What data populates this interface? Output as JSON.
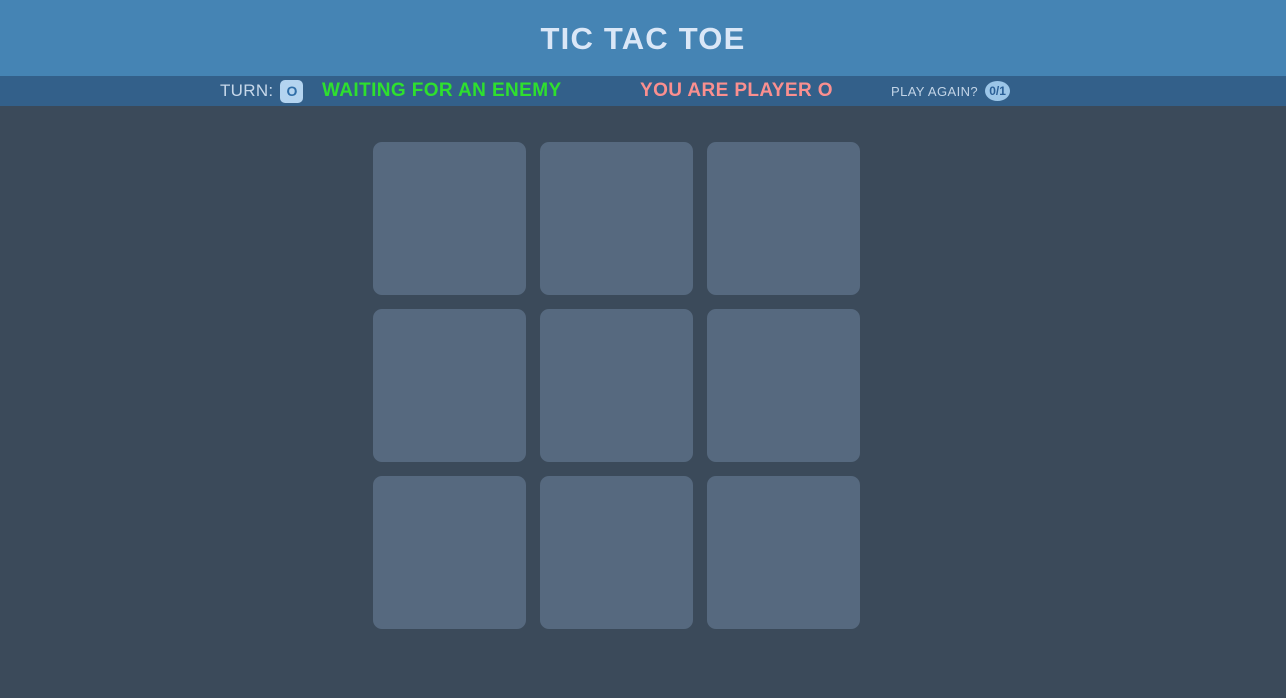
{
  "header": {
    "title": "TIC TAC TOE"
  },
  "statusbar": {
    "turn_label": "TURN:",
    "turn_badge": "O",
    "waiting_text": "WAITING FOR AN ENEMY",
    "player_text": "YOU ARE PLAYER O",
    "play_again_label": "PLAY AGAIN?",
    "play_again_badge": "0/1"
  },
  "board": {
    "cells": [
      "",
      "",
      "",
      "",
      "",
      "",
      "",
      "",
      ""
    ]
  },
  "colors": {
    "header_bg": "#4584b4",
    "statusbar_bg": "#33608a",
    "page_bg": "#3b4a5a",
    "cell_bg": "#56697f",
    "title_text": "#dae7f7",
    "waiting_text": "#2ee02e",
    "player_text": "#fa8f8f",
    "badge_bg": "#b4d4f0",
    "badge_text": "#2f6ea8"
  }
}
